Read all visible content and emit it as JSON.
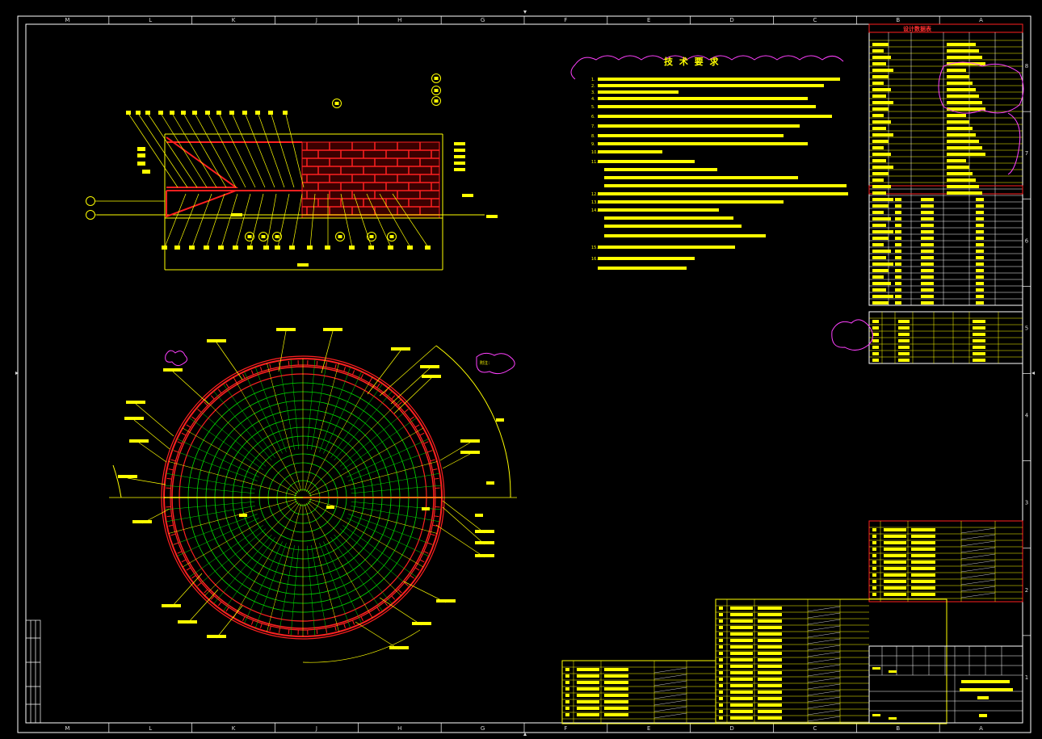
{
  "drawing": {
    "grid_columns_top": [
      "M",
      "L",
      "K",
      "J",
      "H",
      "G",
      "F",
      "E",
      "D",
      "C",
      "B",
      "A"
    ],
    "grid_rows_right": [
      "8",
      "7",
      "6",
      "5",
      "4",
      "3",
      "2",
      "1"
    ],
    "tech_requirements_title": "技 术 要 求",
    "tech_requirement_numbers": [
      "1.",
      "2.",
      "3.",
      "4.",
      "5.",
      "6.",
      "7.",
      "8.",
      "9.",
      "10.",
      "11.",
      "12.",
      "13.",
      "14.",
      "15.",
      "16."
    ],
    "title_block_heading": "设计数据表",
    "note_label": "附注：",
    "main_part_labels": [
      "A",
      "B",
      "C",
      "D",
      "E",
      "F",
      "G",
      "H",
      "I"
    ],
    "leader_label_samples": [
      "1",
      "2",
      "3",
      "4",
      "5",
      "6",
      "7",
      "8",
      "9",
      "10",
      "11",
      "12",
      "13"
    ]
  },
  "colors": {
    "background": "#000000",
    "frame": "#ffffff",
    "text": "#ffff00",
    "accent_red": "#ff2020",
    "accent_green": "#00e000",
    "accent_magenta": "#ff40ff",
    "accent_cyan": "#00ffff"
  }
}
